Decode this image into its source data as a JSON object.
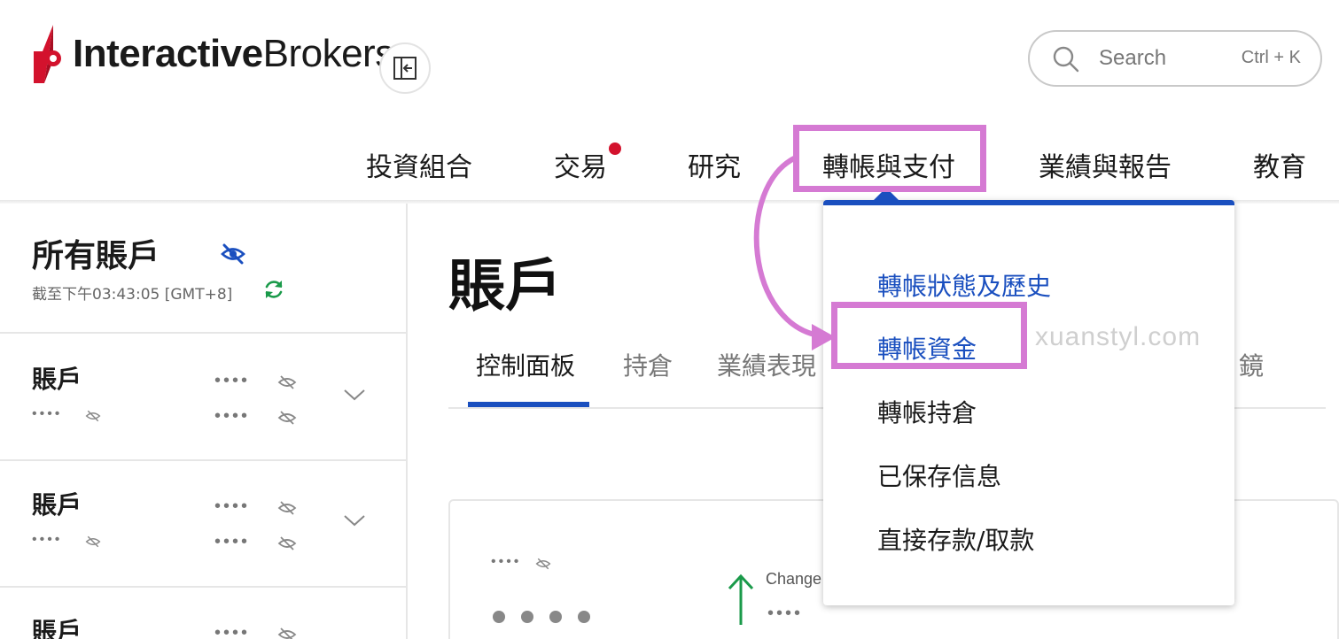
{
  "brand": {
    "name_bold": "Interactive",
    "name_regular": "Brokers"
  },
  "search": {
    "placeholder": "Search",
    "shortcut": "Ctrl + K"
  },
  "nav": {
    "items": [
      "投資組合",
      "交易",
      "研究",
      "轉帳與支付",
      "業績與報告",
      "教育"
    ],
    "notification_dot_on": "交易"
  },
  "sidebar": {
    "title": "所有賬戶",
    "timestamp": "截至下午03:43:05 [GMT+8]",
    "accounts": [
      {
        "label": "賬戶",
        "mask_id": "••••",
        "mask_value_1": "••••",
        "mask_value_2": "••••"
      },
      {
        "label": "賬戶",
        "mask_id": "••••",
        "mask_value_1": "••••",
        "mask_value_2": "••••"
      },
      {
        "label": "賬戶",
        "mask_id": "••••",
        "mask_value_1": "••••",
        "mask_value_2": "••••"
      }
    ]
  },
  "main": {
    "title": "賬戶",
    "tabs": [
      "控制面板",
      "持倉",
      "業績表現",
      "鏡"
    ],
    "active_tab": "控制面板",
    "card": {
      "mask_small": "••••",
      "change_label": "Change",
      "change_mask": "••••"
    }
  },
  "dropdown": {
    "items": [
      "轉帳狀態及歷史",
      "轉帳資金",
      "轉帳持倉",
      "已保存信息",
      "直接存款/取款"
    ]
  },
  "watermark": "xuanstyl.com",
  "colors": {
    "accent_blue": "#1a4fbf",
    "brand_red": "#d3122d",
    "highlight_pink": "#d57ad3",
    "positive_green": "#1a9a4a"
  }
}
